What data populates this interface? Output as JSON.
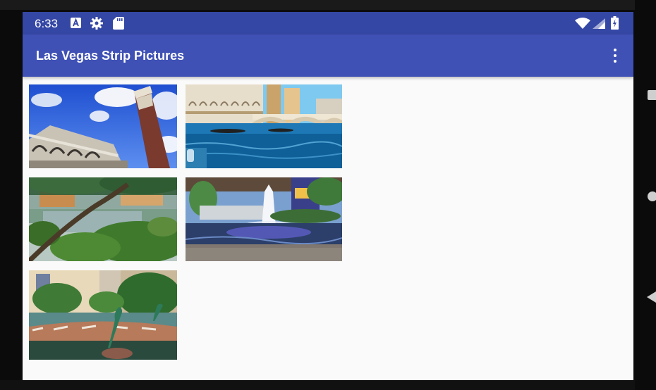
{
  "status_bar": {
    "time": "6:33",
    "icons": [
      "a-notification-icon",
      "gear-icon",
      "sd-card-icon",
      "wifi-icon",
      "signal-icon",
      "battery-charging-icon"
    ]
  },
  "app_bar": {
    "title": "Las Vegas Strip Pictures",
    "overflow_icon": "more-vert-icon"
  },
  "gallery": {
    "items": [
      {
        "name": "photo-venetian-tower"
      },
      {
        "name": "photo-venetian-canal"
      },
      {
        "name": "photo-garden-pond"
      },
      {
        "name": "photo-fountain"
      },
      {
        "name": "photo-dolphin-fountain"
      }
    ]
  },
  "nav_buttons": [
    "recents-icon",
    "home-icon",
    "back-icon"
  ],
  "colors": {
    "status_bar": "#3547a4",
    "app_bar": "#3f51b5",
    "background": "#fafafa"
  }
}
